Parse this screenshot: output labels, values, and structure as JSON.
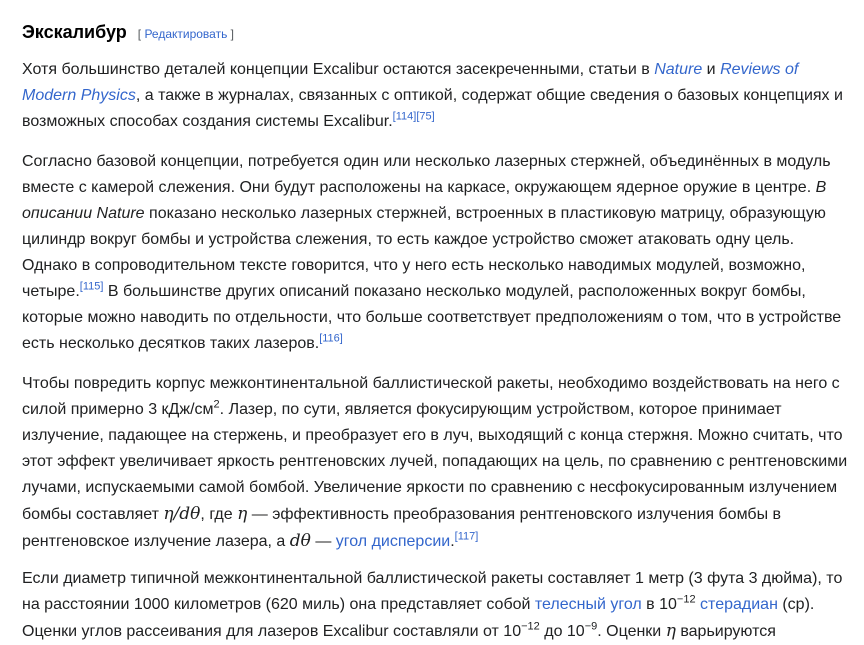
{
  "section": {
    "title": "Экскалибур",
    "edit_open": "[ ",
    "edit_label": "Редактировать",
    "edit_close": " ]"
  },
  "p1": {
    "t1": "Хотя большинство деталей концепции Excalibur остаются засекреченными, статьи в ",
    "link_nature": "Nature",
    "t2": " и ",
    "link_rmp": "Reviews of Modern Physics",
    "t3": ", а также в журналах, связанных с оптикой, содержат общие сведения о базовых концепциях и возможных способах создания системы Excalibur.",
    "ref1": "[114]",
    "ref2": "[75]"
  },
  "p2": {
    "t1": "Согласно базовой концепции, потребуется один или несколько лазерных стержней, объединённых в модуль вместе с камерой слежения. Они будут расположены на каркасе, окружающем ядерное оружие в центре. ",
    "italic": "В описании Nature",
    "t2": " показано несколько лазерных стержней, встроенных в пластиковую матрицу, образующую цилиндр вокруг бомбы и устройства слежения, то есть каждое устройство сможет атаковать одну цель. Однако в сопроводительном тексте говорится, что у него есть несколько наводимых модулей, возможно, четыре.",
    "ref1": "[115]",
    "t3": " В большинстве других описаний показано несколько модулей, расположенных вокруг бомбы, которые можно наводить по отдельности, что больше соответствует предположениям о том, что в устройстве есть несколько десятков таких лазеров.",
    "ref2": "[116]"
  },
  "p3": {
    "t1": "Чтобы повредить корпус межконтинентальной баллистической ракеты, необходимо воздействовать на него с силой примерно 3  кДж/см",
    "sup2": "2",
    "t2": ". Лазер, по сути, является фокусирующим устройством, которое принимает излучение, падающее на стержень, и преобразует его в луч, выходящий с конца стержня. Можно считать, что этот эффект увеличивает яркость рентгеновских лучей, попадающих на цель, по сравнению с рентгеновскими лучами, испускаемыми самой бомбой. Увеличение яркости по сравнению с несфокусированным излучением бомбы составляет ",
    "math1": "η/dθ",
    "t3": ", где ",
    "math2": "η",
    "t4": " — эффективность преобразования рентгеновского излучения бомбы в рентгеновское излучение лазера, а ",
    "math3": "dθ",
    "t5": " — ",
    "link_dispersion": "угол дисперсии",
    "t6": ".",
    "ref1": "[117]"
  },
  "p4": {
    "t1": "Если диаметр типичной межконтинентальной баллистической ракеты составляет 1 метр (3 фута 3 дюйма), то на расстоянии 1000 километров (620 миль) она представляет собой ",
    "link_solid": "телесный угол",
    "t2": " в 10",
    "sup1": "−12",
    "t3": " ",
    "link_sr": "стерадиан",
    "t4": " (ср). Оценки углов рассеивания для лазеров Excalibur составляли от 10",
    "sup2": "−12",
    "t5": " до 10",
    "sup3": "−9",
    "t6": ". Оценки ",
    "math1": "η",
    "t7": " варьируются"
  }
}
